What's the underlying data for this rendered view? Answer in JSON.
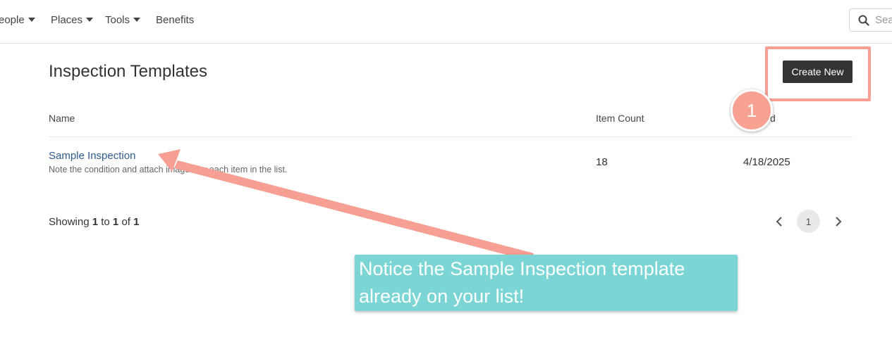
{
  "nav": {
    "items": [
      {
        "label": "eople",
        "has_caret": true
      },
      {
        "label": "Places",
        "has_caret": true
      },
      {
        "label": "Tools",
        "has_caret": true
      },
      {
        "label": "Benefits",
        "has_caret": false
      }
    ],
    "search_placeholder": "Sea"
  },
  "page": {
    "title": "Inspection Templates",
    "create_button": "Create New"
  },
  "table": {
    "columns": {
      "name": "Name",
      "item_count": "Item Count",
      "date_tail": "d"
    },
    "rows": [
      {
        "name": "Sample Inspection",
        "description": "Note the condition and attach images for each item in the list.",
        "item_count": "18",
        "date": "4/18/2025"
      }
    ]
  },
  "footer": {
    "showing_prefix": "Showing",
    "from": "1",
    "to_word": "to",
    "to": "1",
    "of_word": "of",
    "total": "1",
    "current_page": "1"
  },
  "tutorial": {
    "step_number": "1",
    "callout_text": "Notice the Sample Inspection template already on your list!",
    "accent_color": "#f79f92",
    "callout_color": "#7cd5d5"
  }
}
